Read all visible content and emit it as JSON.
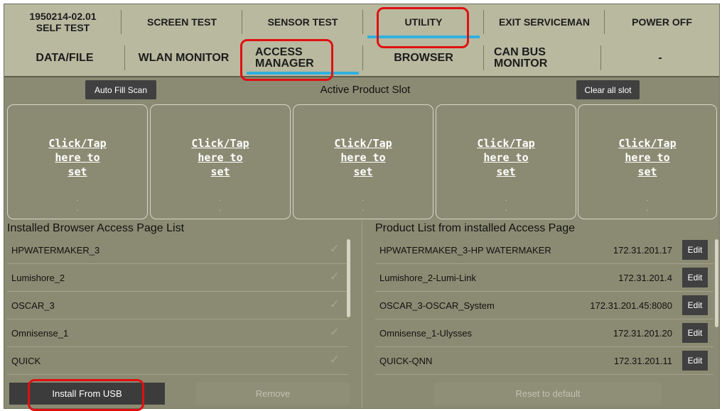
{
  "top_tabs": [
    {
      "line1": "1950214-02.01",
      "line2": "SELF TEST"
    },
    {
      "label": "SCREEN TEST"
    },
    {
      "label": "SENSOR TEST"
    },
    {
      "label": "UTILITY"
    },
    {
      "label": "EXIT SERVICEMAN"
    },
    {
      "label": "POWER OFF"
    }
  ],
  "sub_tabs": [
    {
      "label": "DATA/FILE"
    },
    {
      "label": "WLAN MONITOR"
    },
    {
      "line1": "ACCESS",
      "line2": "MANAGER"
    },
    {
      "label": "BROWSER"
    },
    {
      "line1": "CAN BUS",
      "line2": "MONITOR"
    },
    {
      "label": "-"
    }
  ],
  "controls": {
    "auto_fill_scan": "Auto Fill Scan",
    "active_slot_title": "Active Product Slot",
    "clear_all_slot": "Clear all slot"
  },
  "slots": [
    {
      "line1": "Click/Tap",
      "line2": "here to",
      "line3": "set",
      "dot": "."
    },
    {
      "line1": "Click/Tap",
      "line2": "here to",
      "line3": "set",
      "dot": "."
    },
    {
      "line1": "Click/Tap",
      "line2": "here to",
      "line3": "set",
      "dot": "."
    },
    {
      "line1": "Click/Tap",
      "line2": "here to",
      "line3": "set",
      "dot": "."
    },
    {
      "line1": "Click/Tap",
      "line2": "here to",
      "line3": "set",
      "dot": "."
    }
  ],
  "installed_list": {
    "title": "Installed Browser Access Page List",
    "rows": [
      {
        "name": "HPWATERMAKER_3"
      },
      {
        "name": "Lumishore_2"
      },
      {
        "name": "OSCAR_3"
      },
      {
        "name": "Omnisense_1"
      },
      {
        "name": "QUICK"
      }
    ],
    "check_glyph": "✓"
  },
  "product_list": {
    "title": "Product List from installed Access Page",
    "edit_label": "Edit",
    "rows": [
      {
        "name": "HPWATERMAKER_3-HP WATERMAKER",
        "ip": "172.31.201.17"
      },
      {
        "name": "Lumishore_2-Lumi-Link",
        "ip": "172.31.201.4"
      },
      {
        "name": "OSCAR_3-OSCAR_System",
        "ip": "172.31.201.45:8080"
      },
      {
        "name": "Omnisense_1-Ulysses",
        "ip": "172.31.201.20"
      },
      {
        "name": "QUICK-QNN",
        "ip": "172.31.201.11"
      }
    ]
  },
  "bottom_buttons": {
    "install_usb": "Install From USB",
    "remove": "Remove",
    "reset_default": "Reset to default"
  },
  "colors": {
    "panel": "#8b8b73",
    "tab_bar": "#b9b9a0",
    "active_underline": "#30b0e0",
    "highlight": "#e01010",
    "button_dark": "#404040"
  }
}
